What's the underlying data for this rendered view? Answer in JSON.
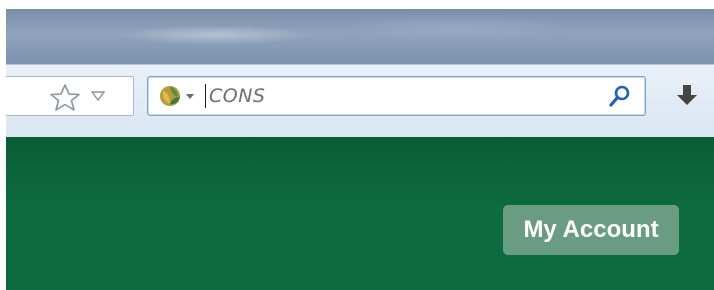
{
  "search": {
    "value": "CONS",
    "engine_icon": "search-engine-logo-icon"
  },
  "toolbar": {
    "bookmark_icon": "star-icon",
    "downloads_icon": "download-arrow-icon"
  },
  "page": {
    "account_label": "My Account",
    "banner_color": "#0d6b3f",
    "button_color": "#6a9c84"
  }
}
